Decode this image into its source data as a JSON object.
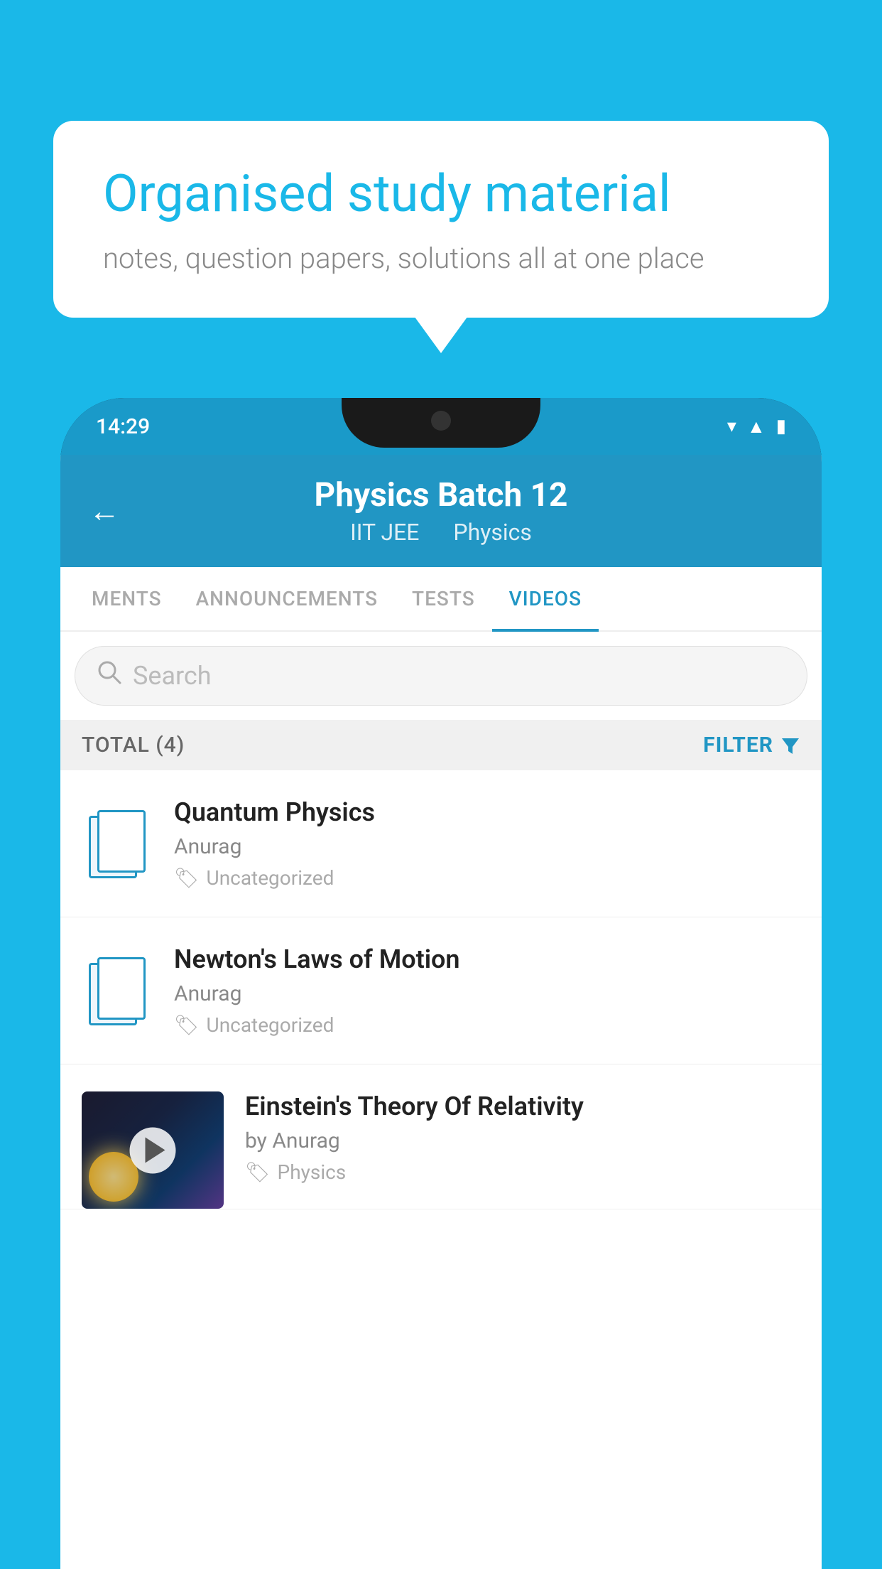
{
  "background": {
    "color": "#1ab8e8"
  },
  "speech_bubble": {
    "title": "Organised study material",
    "subtitle": "notes, question papers, solutions all at one place"
  },
  "phone": {
    "status_bar": {
      "time": "14:29",
      "icons": [
        "wifi",
        "signal",
        "battery"
      ]
    },
    "header": {
      "back_label": "←",
      "title": "Physics Batch 12",
      "subtitle_parts": [
        "IIT JEE",
        "Physics"
      ]
    },
    "tabs": [
      {
        "label": "MENTS",
        "active": false
      },
      {
        "label": "ANNOUNCEMENTS",
        "active": false
      },
      {
        "label": "TESTS",
        "active": false
      },
      {
        "label": "VIDEOS",
        "active": true
      }
    ],
    "search": {
      "placeholder": "Search"
    },
    "filter_bar": {
      "total_label": "TOTAL (4)",
      "filter_label": "FILTER"
    },
    "video_items": [
      {
        "title": "Quantum Physics",
        "author": "Anurag",
        "tag": "Uncategorized",
        "type": "doc"
      },
      {
        "title": "Newton's Laws of Motion",
        "author": "Anurag",
        "tag": "Uncategorized",
        "type": "doc"
      },
      {
        "title": "Einstein's Theory Of Relativity",
        "author": "by Anurag",
        "tag": "Physics",
        "type": "video"
      }
    ]
  }
}
